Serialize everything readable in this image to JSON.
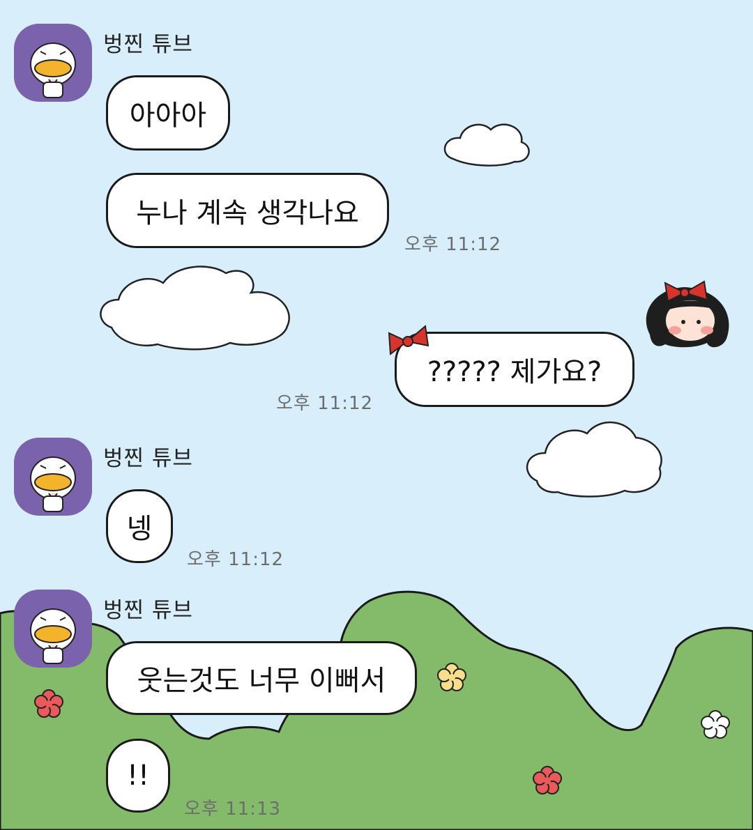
{
  "colors": {
    "sky": "#d9eefb",
    "hill": "#84bb6a",
    "avatar_bg": "#7a62ac",
    "time_text": "#6d6d6d",
    "bow": "#d8342c"
  },
  "contact": {
    "name": "벙찐 튜브",
    "avatar_icon": "tube-duck-avatar-icon"
  },
  "messages": [
    {
      "name": "벙찐 튜브",
      "bubbles": [
        "아아아",
        "누나 계속 생각나요"
      ],
      "time": "오후 11:12"
    },
    {
      "outgoing": true,
      "bubbles": [
        "????? 제가요?"
      ],
      "time": "오후 11:12",
      "decoration": "red-bow-icon",
      "avatar_icon": "girl-with-bow-icon"
    },
    {
      "name": "벙찐 튜브",
      "bubbles": [
        "넹"
      ],
      "time": "오후 11:12"
    },
    {
      "name": "벙찐 튜브",
      "bubbles": [
        "웃는것도 너무 이뻐서",
        "!!"
      ],
      "time": "오후 11:13"
    }
  ]
}
